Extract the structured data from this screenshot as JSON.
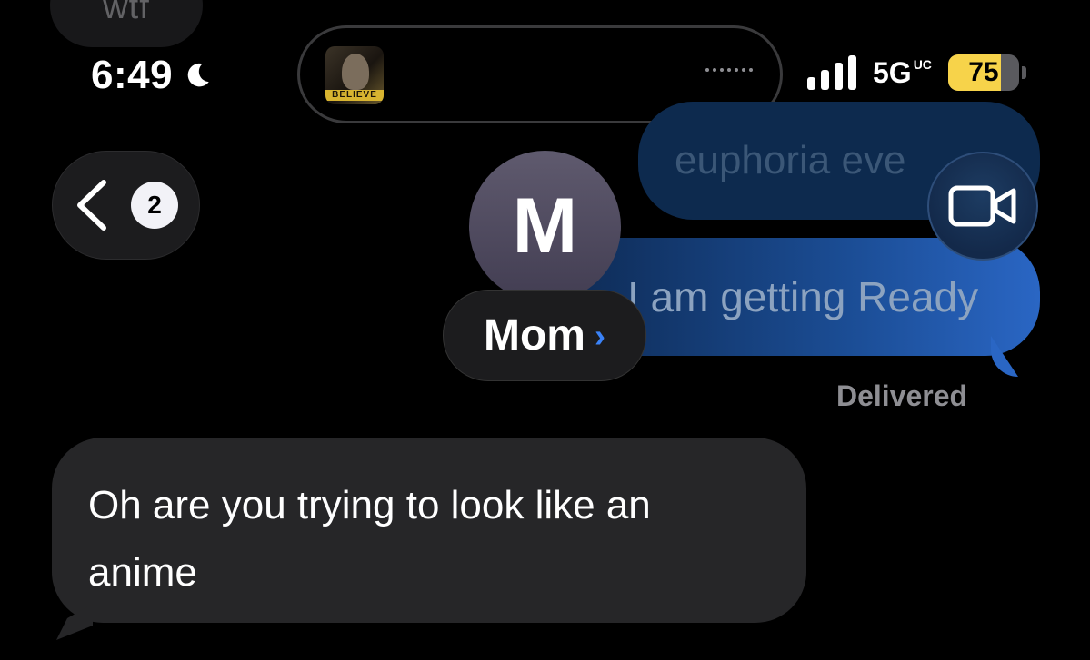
{
  "conversation": {
    "previous_incoming_faded": "wtf",
    "outgoing_faded": "euphoria eve",
    "outgoing_last": "I am getting Ready",
    "delivery_status": "Delivered",
    "incoming_message": "Oh are you trying to look like an anime"
  },
  "status_bar": {
    "time": "6:49",
    "network": "5G",
    "network_super": "UC",
    "battery_percent": "75",
    "battery_level": 0.75,
    "focus_icon": "moon-icon",
    "now_playing_album_text": "BELIEVE"
  },
  "header": {
    "back_badge_count": "2",
    "avatar_initial": "M",
    "contact_name": "Mom",
    "video_icon": "video-camera-icon"
  },
  "colors": {
    "accent_blue": "#3a82f7",
    "battery_yellow": "#f7d34a",
    "incoming_bubble": "#262628",
    "outgoing_bubble": "#2a66c4"
  }
}
